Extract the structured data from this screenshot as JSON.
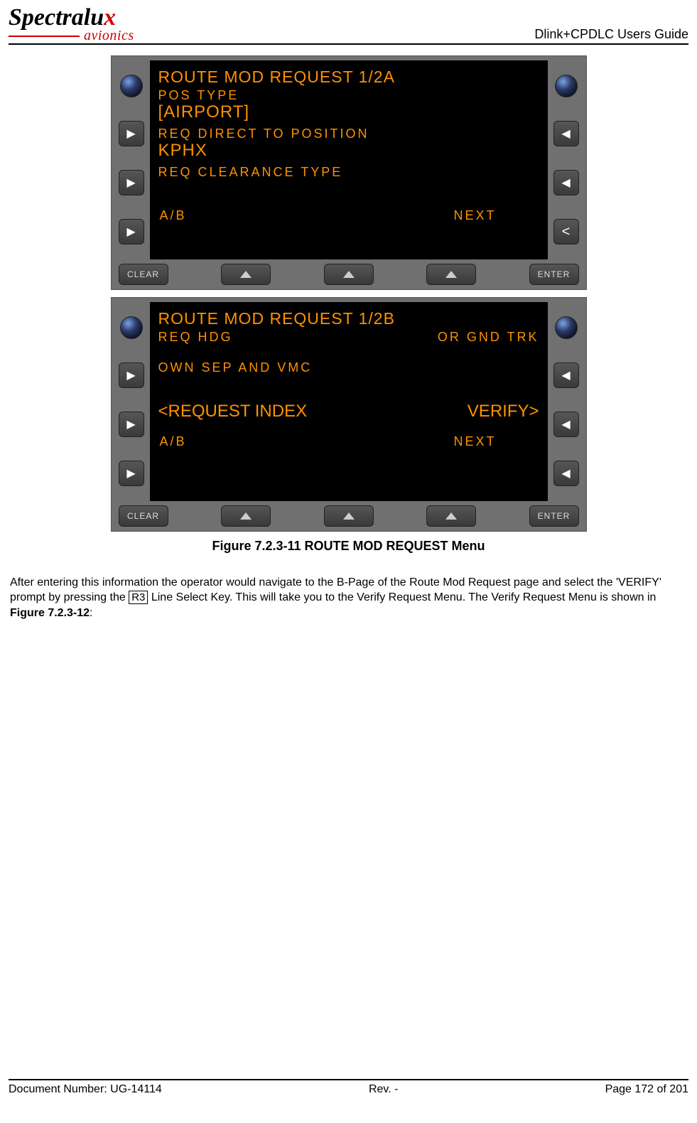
{
  "header": {
    "logo_main": "Spectralux",
    "logo_sub": "avionics",
    "doc_title": "Dlink+CPDLC Users Guide"
  },
  "device1": {
    "title": "ROUTE MOD REQUEST 1/2A",
    "l1_label": "POS TYPE",
    "l1_value": "[AIRPORT]",
    "l2_label": "REQ DIRECT TO POSITION",
    "l2_value": "KPHX",
    "l3_label": "REQ CLEARANCE TYPE",
    "footer_left": "A/B",
    "footer_right": "NEXT",
    "btn_clear": "CLEAR",
    "btn_enter": "ENTER"
  },
  "device2": {
    "title": "ROUTE MOD REQUEST 1/2B",
    "row1_left": "REQ HDG",
    "row1_right": "OR GND TRK",
    "row2": "OWN SEP AND VMC",
    "action_left": "<REQUEST INDEX",
    "action_right": "VERIFY>",
    "footer_left": "A/B",
    "footer_right": "NEXT",
    "btn_clear": "CLEAR",
    "btn_enter": "ENTER"
  },
  "figure_caption": "Figure 7.2.3-11 ROUTE MOD REQUEST Menu",
  "body": {
    "p1a": "After entering this information the operator would navigate to the B-Page of the Route Mod Request page and select the 'VERIFY' prompt by pressing the ",
    "key": "R3",
    "p1b": " Line Select Key. This will take you to the Verify Request Menu. The Verify Request Menu is shown in ",
    "figref": "Figure 7.2.3-12",
    "p1c": ":"
  },
  "footer": {
    "left": "Document Number:  UG-14114",
    "center": "Rev. -",
    "right": "Page 172 of 201"
  }
}
